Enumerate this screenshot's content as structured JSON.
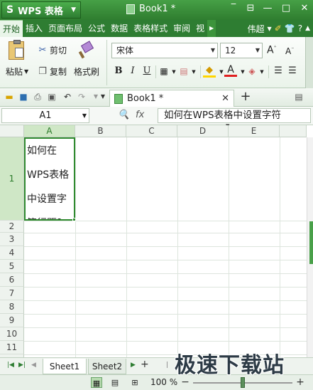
{
  "app": {
    "logo": "S",
    "name": "WPS 表格",
    "document_title": "Book1 *"
  },
  "window_controls": [
    "‾",
    "⊟",
    "—",
    "□",
    "✕"
  ],
  "menu": {
    "items": [
      "开始",
      "插入",
      "页面布局",
      "公式",
      "数据",
      "表格样式",
      "审阅",
      "视"
    ],
    "active": "开始",
    "user": "伟超"
  },
  "ribbon": {
    "paste": "粘贴",
    "cut": "剪切",
    "copy": "复制",
    "format_painter": "格式刷",
    "font_name": "宋体",
    "font_size": "12"
  },
  "quick_access": {
    "tab_name": "Book1 *"
  },
  "formula_bar": {
    "cell_ref": "A1",
    "fx": "fx",
    "content": "如何在WPS表格中设置字符"
  },
  "grid": {
    "columns": [
      "A",
      "B",
      "C",
      "D",
      "E"
    ],
    "rows": [
      "1",
      "2",
      "3",
      "4",
      "5",
      "6",
      "7",
      "8",
      "9",
      "10",
      "11"
    ],
    "a1_lines": [
      "如何在",
      "WPS表格",
      "中设置字",
      "符行距？"
    ]
  },
  "sheets": {
    "tabs": [
      "Sheet1",
      "Sheet2"
    ],
    "active": "Sheet1",
    "add": "+"
  },
  "status": {
    "zoom": "100 %",
    "zoom_fraction": 0.5
  },
  "watermark": "极速下载站",
  "colors": {
    "accent": "#2e7d32",
    "selection": "#2f8a2f"
  }
}
